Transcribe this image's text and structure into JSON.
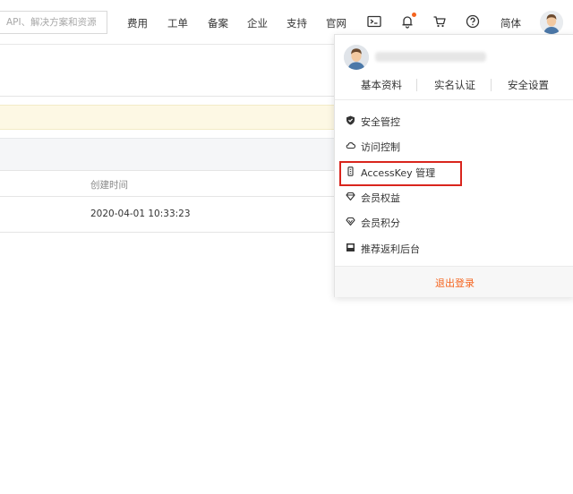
{
  "topbar": {
    "search_placeholder": "API、解决方案和资源",
    "nav": [
      "费用",
      "工单",
      "备案",
      "企业",
      "支持",
      "官网"
    ],
    "language": "简体",
    "icons": [
      "terminal-icon",
      "bell-icon",
      "cart-icon",
      "help-icon"
    ],
    "notify_dot_color": "#f5641e"
  },
  "table": {
    "columns": [
      "创建时间"
    ],
    "rows": [
      {
        "created_at": "2020-04-01 10:33:23"
      }
    ]
  },
  "user_menu": {
    "profile_links": [
      "基本资料",
      "实名认证",
      "安全设置"
    ],
    "items": [
      {
        "label": "安全管控",
        "icon": "shield-icon"
      },
      {
        "label": "访问控制",
        "icon": "cloud-icon"
      },
      {
        "label": "AccessKey 管理",
        "icon": "key-icon"
      },
      {
        "label": "会员权益",
        "icon": "diamond-icon"
      },
      {
        "label": "会员积分",
        "icon": "diamond-outline-icon"
      },
      {
        "label": "推荐返利后台",
        "icon": "image-icon"
      }
    ],
    "logout": "退出登录",
    "highlight_color": "#d9251d",
    "accent_color": "#f5641e"
  }
}
